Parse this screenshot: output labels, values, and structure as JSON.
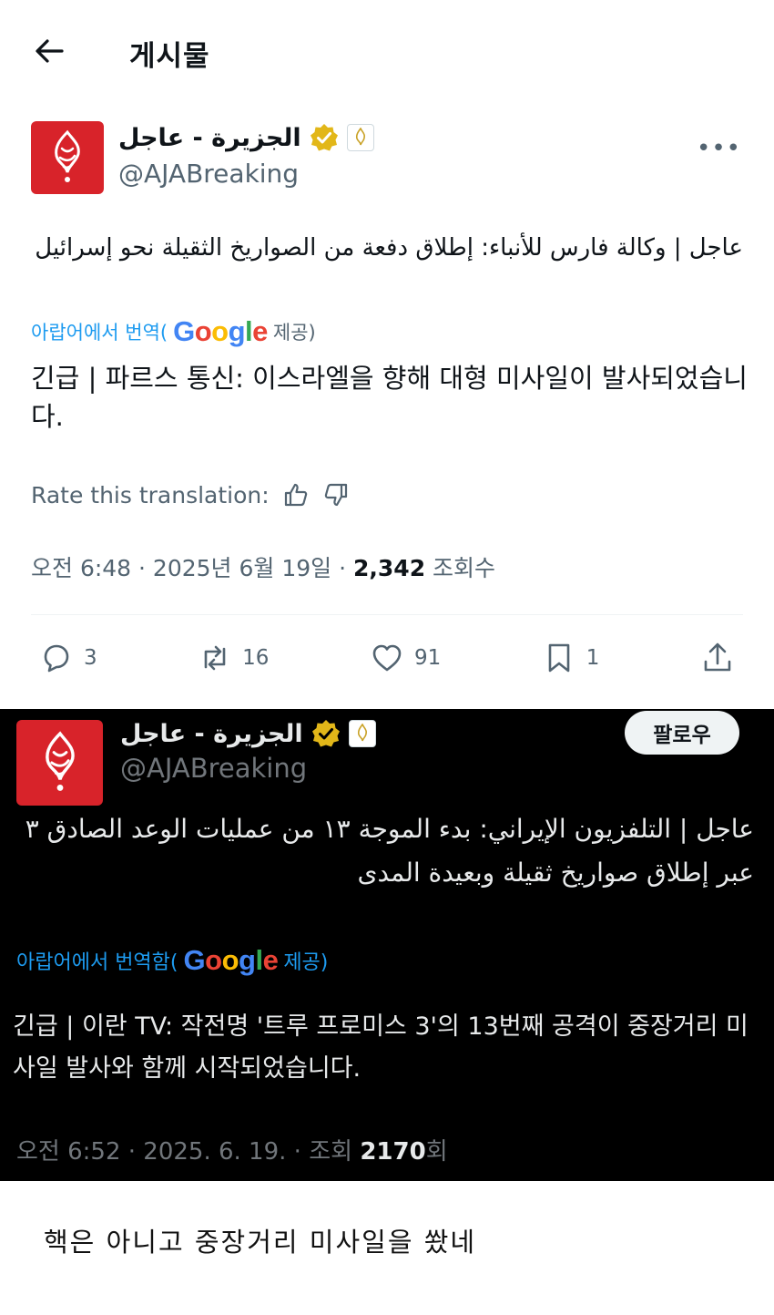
{
  "header": {
    "back_icon": "arrow-left-icon",
    "title": "게시물"
  },
  "post1": {
    "display_name": "الجزيرة - عاجل",
    "handle": "@AJABreaking",
    "verified_icon": "gold-verified-badge-icon",
    "more_icon": "more-horizontal-icon",
    "more_label": "•••",
    "arabic_text": "عاجل | وكالة فارس للأنباء: إطلاق دفعة من الصواريخ الثقيلة نحو إسرائيل",
    "translate_prefix": "아랍어에서 번역(",
    "google_letters": [
      "G",
      "o",
      "o",
      "g",
      "l",
      "e"
    ],
    "translate_suffix": "제공)",
    "translated_text": "긴급 | 파르스 통신: 이스라엘을 향해 대형 미사일이 발사되었습니다.",
    "rate_label": "Rate this translation:",
    "meta_prefix": "오전 6:48 · 2025년 6월 19일 · ",
    "views": "2,342",
    "views_suffix": " 조회수",
    "actions": {
      "replies": "3",
      "reposts": "16",
      "likes": "91",
      "bookmarks": "1"
    }
  },
  "post2": {
    "display_name": "الجزيرة - عاجل",
    "handle": "@AJABreaking",
    "follow_label": "팔로우",
    "arabic_text": "عاجل | التلفزيون الإيراني: بدء الموجة ١٣ من عمليات الوعد الصادق ٣ عبر إطلاق صواريخ ثقيلة وبعيدة المدى",
    "translate_prefix": "아랍어에서 번역함(",
    "google_letters": [
      "G",
      "o",
      "o",
      "g",
      "l",
      "e"
    ],
    "translate_suffix": "제공)",
    "translated_text": "긴급 | 이란 TV: 작전명 '트루 프로미스 3'의 13번째 공격이 중장거리 미사일 발사와 함께 시작되었습니다.",
    "meta_prefix": "오전 6:52 · 2025. 6. 19. · 조회 ",
    "views": "2170",
    "views_suffix": "회"
  },
  "comment": {
    "text": "핵은 아니고 중장거리 미사일을 쐈네"
  },
  "colors": {
    "accent": "#1d9bf0",
    "brand_red": "#d8232a",
    "verified_gold": "#e2b719",
    "dark_bg": "#000000"
  }
}
